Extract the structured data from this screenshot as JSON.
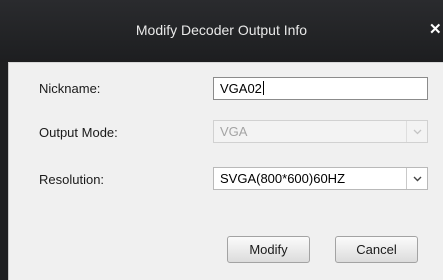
{
  "dialog": {
    "title": "Modify Decoder Output Info",
    "close_glyph": "✕"
  },
  "form": {
    "nickname": {
      "label": "Nickname:",
      "value": "VGA02"
    },
    "output_mode": {
      "label": "Output Mode:",
      "value": "VGA",
      "disabled": true,
      "arrow_icon": "chevron-down-icon"
    },
    "resolution": {
      "label": "Resolution:",
      "value": "SVGA(800*600)60HZ",
      "arrow_icon": "chevron-down-icon"
    }
  },
  "buttons": {
    "modify_label": "Modify",
    "cancel_label": "Cancel"
  },
  "colors": {
    "titlebar": "#1e1f21",
    "panel": "#f0f0f0",
    "disabled_text": "#a4a4a4"
  }
}
